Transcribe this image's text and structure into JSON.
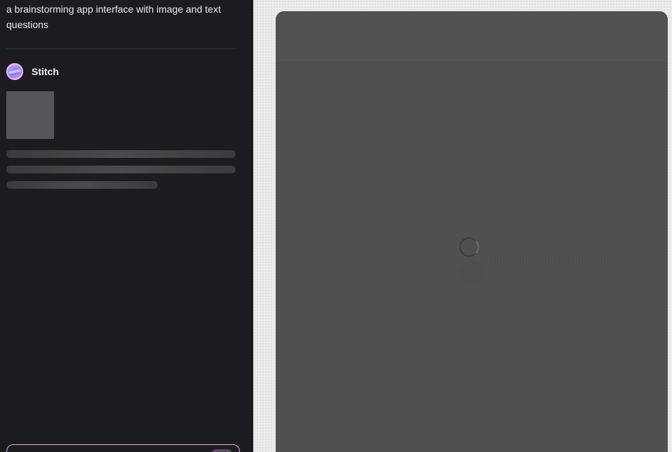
{
  "conversation": {
    "user_prompt": "a brainstorming app interface with image and text questions",
    "agent": {
      "name": "Stitch",
      "avatar_icon": "stitch-logo-icon"
    },
    "response_state": "loading"
  },
  "composer": {
    "accent_color": "#e7a6dd"
  },
  "canvas": {
    "state": "loading",
    "spinner_icon": "spinner-icon"
  },
  "colors": {
    "sidebar_bg": "#1b1c1f",
    "canvas_bg": "#ececec",
    "frame_bg": "#505050"
  }
}
